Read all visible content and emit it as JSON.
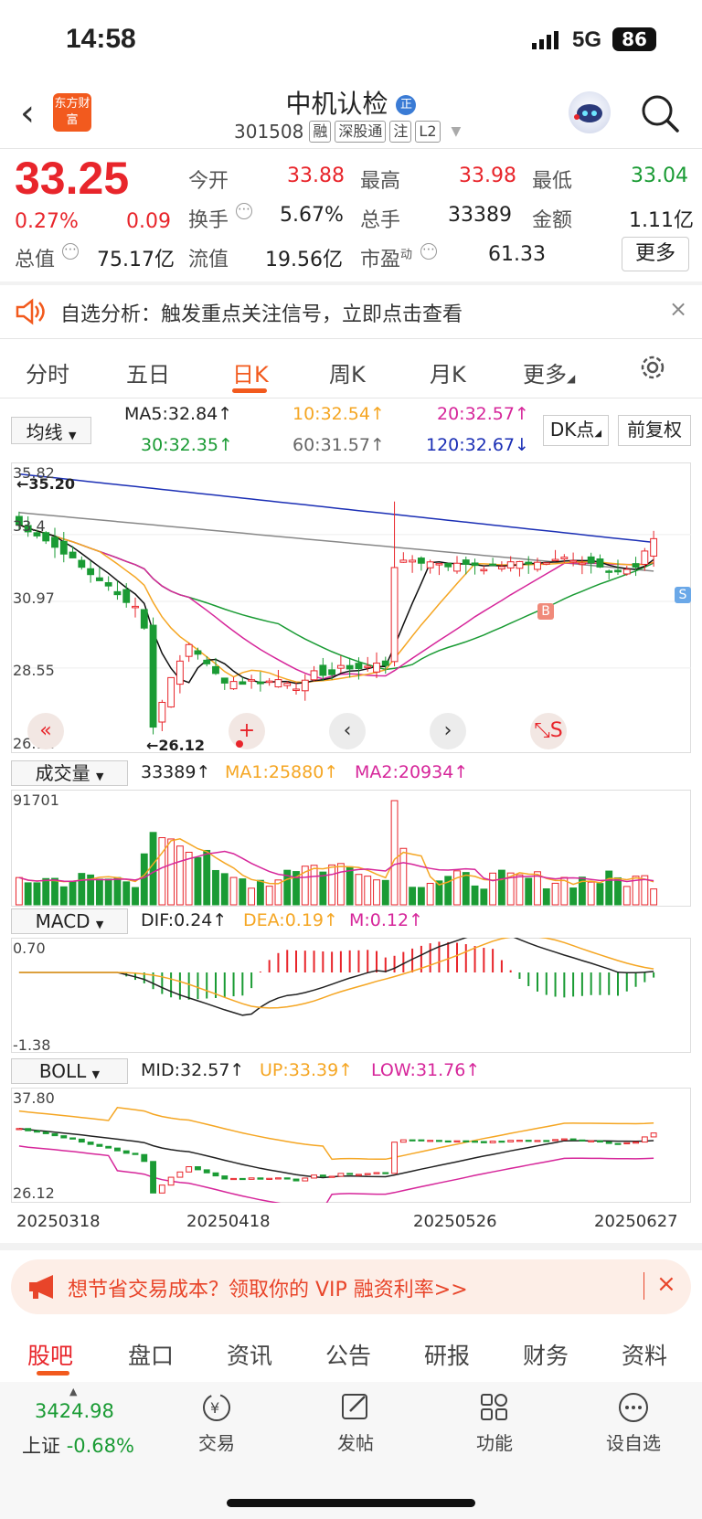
{
  "status": {
    "time": "14:58",
    "network": "5G",
    "battery": "86"
  },
  "header": {
    "logo": "东方财富",
    "name": "中机认检",
    "code": "301508",
    "tags": [
      "融",
      "深股通",
      "注",
      "L2"
    ]
  },
  "quote": {
    "price": "33.25",
    "change_pct": "0.27%",
    "change": "0.09",
    "rows": [
      [
        {
          "label": "今开",
          "value": "33.88",
          "color": "red"
        },
        {
          "label": "最高",
          "value": "33.98",
          "color": "red"
        },
        {
          "label": "最低",
          "value": "33.04",
          "color": "green"
        }
      ],
      [
        {
          "label": "换手",
          "value": "5.67%",
          "color": "gray"
        },
        {
          "label": "总手",
          "value": "33389",
          "color": "gray"
        },
        {
          "label": "金额",
          "value": "1.11亿",
          "color": "gray"
        }
      ],
      [
        {
          "label": "总值",
          "value": "75.17亿",
          "color": "gray"
        },
        {
          "label": "流值",
          "value": "19.56亿",
          "color": "gray"
        },
        {
          "label": "市盈",
          "sup": "动",
          "value": "61.33",
          "color": "gray"
        }
      ]
    ],
    "more_label": "更多"
  },
  "notice": {
    "text": "自选分析：触发重点关注信号，立即点击查看"
  },
  "tabs": {
    "items": [
      "分时",
      "五日",
      "日K",
      "周K",
      "月K",
      "更多"
    ],
    "active": "日K"
  },
  "kline": {
    "selector": "均线",
    "ma": [
      {
        "text": "MA5:32.84↑",
        "color": "#111111"
      },
      {
        "text": "10:32.54↑",
        "color": "#f5a623"
      },
      {
        "text": "20:32.57↑",
        "color": "#d6269a"
      },
      {
        "text": "30:32.35↑",
        "color": "#1a9b34"
      },
      {
        "text": "60:31.57↑",
        "color": "#666666"
      },
      {
        "text": "120:32.67↓",
        "color": "#1b2fb5"
      }
    ],
    "dk_label": "DK点",
    "fq_label": "前复权",
    "y_labels": [
      "35.82",
      "33.4",
      "30.97",
      "28.55",
      "26.12"
    ],
    "high_note": "←35.20",
    "low_note": "←26.12",
    "buy_mark": "B",
    "sell_mark": "S",
    "controls": [
      "«",
      "+",
      "‹",
      "›",
      "⤡S"
    ]
  },
  "volume": {
    "selector": "成交量",
    "values": [
      "33389↑",
      "MA1:25880↑",
      "MA2:20934↑"
    ],
    "max_label": "91701"
  },
  "macd": {
    "selector": "MACD",
    "values": [
      "DIF:0.24↑",
      "DEA:0.19↑",
      "M:0.12↑"
    ],
    "y_labels": [
      "0.70",
      "-1.38"
    ]
  },
  "boll": {
    "selector": "BOLL",
    "values": [
      "MID:32.57↑",
      "UP:33.39↑",
      "LOW:31.76↑"
    ],
    "y_labels": [
      "37.80",
      "26.12"
    ]
  },
  "dates": [
    "20250318",
    "20250418",
    "20250526",
    "20250627"
  ],
  "vip": {
    "text": "想节省交易成本？领取你的 VIP 融资利率>>"
  },
  "bottom_tabs": {
    "items": [
      "股吧",
      "盘口",
      "资讯",
      "公告",
      "研报",
      "财务",
      "资料"
    ],
    "active": "股吧"
  },
  "index": {
    "value": "3424.98",
    "name": "上证",
    "change": "-0.68%"
  },
  "bottom_nav": [
    "交易",
    "发帖",
    "功能",
    "设自选"
  ],
  "colors": {
    "up": "#e8252b",
    "down": "#1a9b34",
    "accent": "#f25a1e"
  }
}
